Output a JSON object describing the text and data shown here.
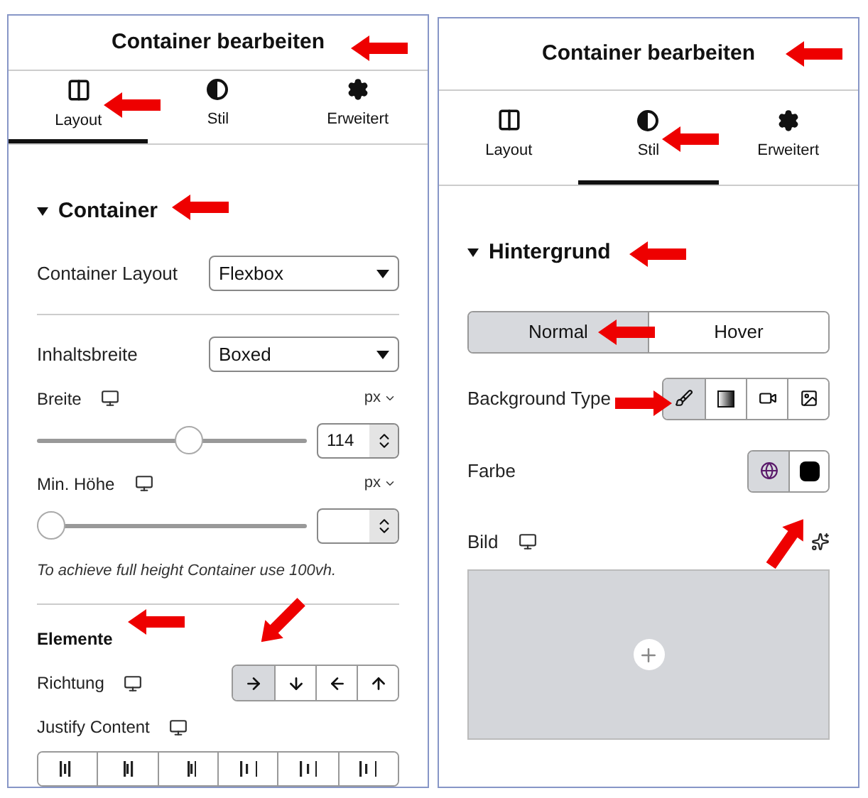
{
  "panels": [
    {
      "title": "Container bearbeiten",
      "tabs": [
        {
          "label": "Layout",
          "selected": true
        },
        {
          "label": "Stil",
          "selected": false
        },
        {
          "label": "Erweitert",
          "selected": false
        }
      ],
      "section": {
        "title": "Container",
        "expanded": true
      },
      "controls": [
        {
          "kind": "select",
          "label": "Container Layout",
          "value": "Flexbox"
        },
        {
          "kind": "divider"
        },
        {
          "kind": "select",
          "label": "Inhaltsbreite",
          "value": "Boxed"
        },
        {
          "kind": "slider",
          "label": "Breite",
          "responsive": true,
          "unit": "px",
          "level": 0.57,
          "value": "114"
        },
        {
          "kind": "slider",
          "label": "Min. Höhe",
          "responsive": true,
          "unit": "px",
          "level": 0
        },
        {
          "kind": "note",
          "text": "To achieve full height Container use 100vh."
        },
        {
          "kind": "divider"
        },
        {
          "kind": "heading",
          "text": "Elemente"
        },
        {
          "kind": "direction",
          "label": "Richtung",
          "responsive": true,
          "options": [
            {
              "selected": true
            },
            {
              "selected": false
            },
            {
              "selected": false
            },
            {
              "selected": false
            }
          ]
        },
        {
          "kind": "justify",
          "label": "Justify Content",
          "responsive": true
        }
      ]
    },
    {
      "title": "Container bearbeiten",
      "tabs": [
        {
          "label": "Layout",
          "selected": false
        },
        {
          "label": "Stil",
          "selected": true
        },
        {
          "label": "Erweitert",
          "selected": false
        }
      ],
      "section": {
        "title": "Hintergrund",
        "expanded": true
      },
      "controls": [
        {
          "kind": "toggle",
          "options": [
            {
              "label": "Normal",
              "selected": true
            },
            {
              "label": "Hover",
              "selected": false
            }
          ]
        },
        {
          "kind": "bgtype",
          "label": "Background Type",
          "options": [
            {
              "selected": true
            },
            {
              "selected": false
            },
            {
              "selected": false
            },
            {
              "selected": false
            }
          ]
        },
        {
          "kind": "color",
          "label": "Farbe"
        },
        {
          "kind": "image",
          "label": "Bild",
          "responsive": true
        }
      ]
    }
  ]
}
